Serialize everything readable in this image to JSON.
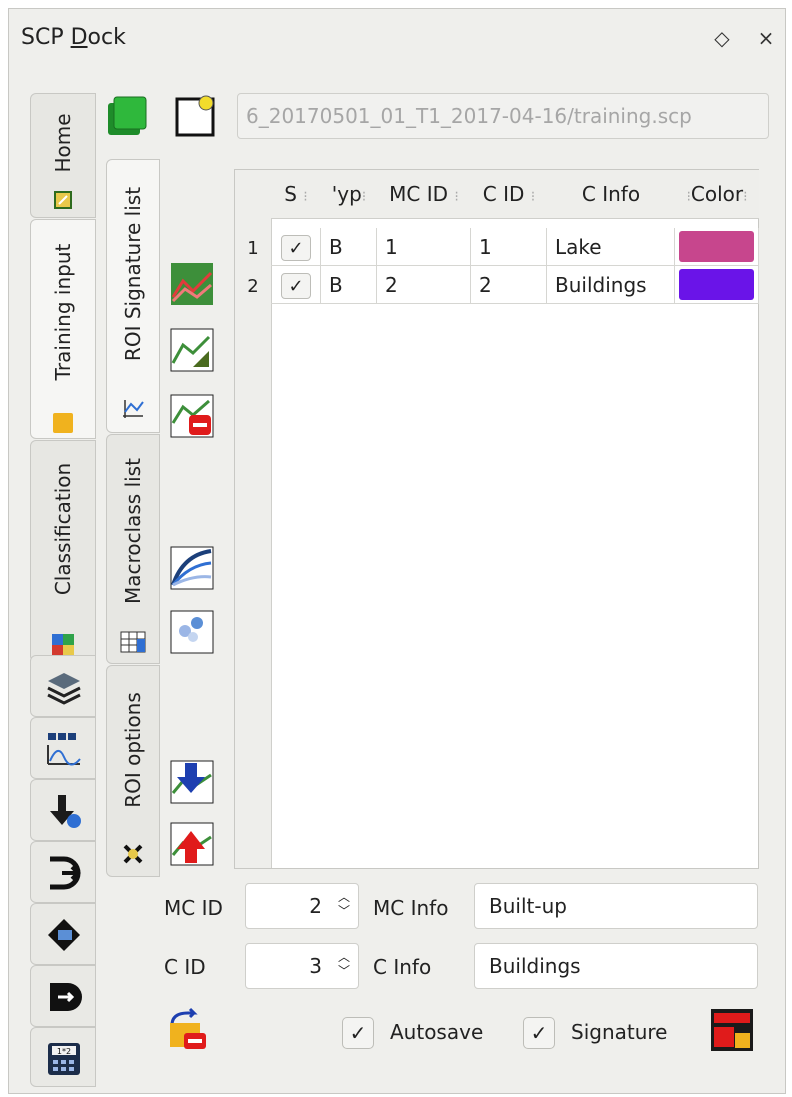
{
  "window": {
    "title_pre": "SCP ",
    "title_underlined": "D",
    "title_post": "ock",
    "float_glyph": "◇",
    "close_glyph": "×"
  },
  "main_tabs": [
    "Home",
    "Training input",
    "Classification"
  ],
  "sub_tabs": [
    "ROI Signature list",
    "Macroclass list",
    "ROI options"
  ],
  "training_path": "6_20170501_01_T1_2017-04-16/training.scp",
  "table": {
    "headers": [
      "S",
      "Type",
      "MC ID",
      "C ID",
      "C Info",
      "Color"
    ],
    "headers_visible": [
      "S",
      "'yp",
      "MC ID",
      "C ID",
      "C Info",
      "Color"
    ],
    "rows": [
      {
        "num": "1",
        "checked": "✓",
        "type": "B",
        "mc_id": "1",
        "c_id": "1",
        "c_info": "Lake",
        "color": "#c7468d"
      },
      {
        "num": "2",
        "checked": "✓",
        "type": "B",
        "mc_id": "2",
        "c_id": "2",
        "c_info": "Buildings",
        "color": "#6a14e8"
      }
    ]
  },
  "form": {
    "mc_id_label": "MC ID",
    "mc_id_value": "2",
    "mc_info_label": "MC Info",
    "mc_info_value": "Built-up",
    "c_id_label": "C ID",
    "c_id_value": "3",
    "c_info_label": "C Info",
    "c_info_value": "Buildings"
  },
  "options": {
    "autosave_label": "Autosave",
    "autosave_checked": "✓",
    "signature_label": "Signature",
    "signature_checked": "✓"
  },
  "icons": [
    "add-layer-icon",
    "new-file-icon",
    "signature-plot-icon",
    "scatter-plot-icon",
    "delete-signature-icon",
    "spectral-plot-icon",
    "import-icon",
    "export-icon",
    "undo-icon",
    "calculator-icon"
  ]
}
